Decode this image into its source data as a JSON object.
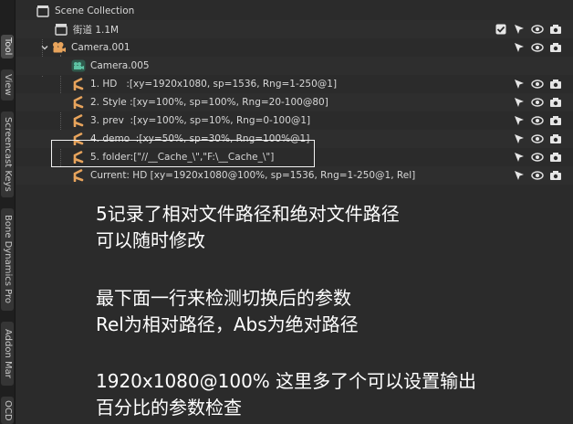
{
  "side_tabs": [
    "Tool",
    "View",
    "Screencast Keys",
    "Bone Dynamics Pro",
    "Addon Mar",
    "OCD"
  ],
  "outliner": {
    "scene_collection": "Scene Collection",
    "collection": {
      "label": "街道 1.1M"
    },
    "camera": {
      "label": "Camera.001"
    },
    "child_camera": {
      "label": "Camera.005"
    },
    "entries": [
      {
        "label": "1. HD   :[xy=1920x1080, sp=1536, Rng=1-250@1]"
      },
      {
        "label": "2. Style :[xy=100%, sp=100%, Rng=20-100@80]"
      },
      {
        "label": "3. prev  :[xy=100%, sp=10%, Rng=0-100@1]"
      },
      {
        "label": "4. demo  :[xy=50%, sp=30%, Rng=100%@1]"
      },
      {
        "label": "5. folder:[\"//__Cache_\\\",\"F:\\__Cache_\\\"]"
      },
      {
        "label": "Current: HD [xy=1920x1080@100%, sp=1536, Rng=1-250@1, Rel]"
      }
    ]
  },
  "overlay_text": {
    "line1": "5记录了相对文件路径和绝对文件路径",
    "line2": "可以随时修改",
    "line3": "最下面一行来检测切换后的参数",
    "line4": "Rel为相对路径，Abs为绝对路径",
    "line5": "1920x1080@100% 这里多了个可以设置输出",
    "line6": "百分比的参数检查"
  },
  "colors": {
    "panel_bg": "#2b2b2b",
    "collection_icon": "#d9d9d9",
    "camera_icon": "#e8a45c",
    "camera_data_icon": "#5ec4a4",
    "marker_icon": "#e8a45c",
    "highlight_box": "#f2f2f2"
  }
}
